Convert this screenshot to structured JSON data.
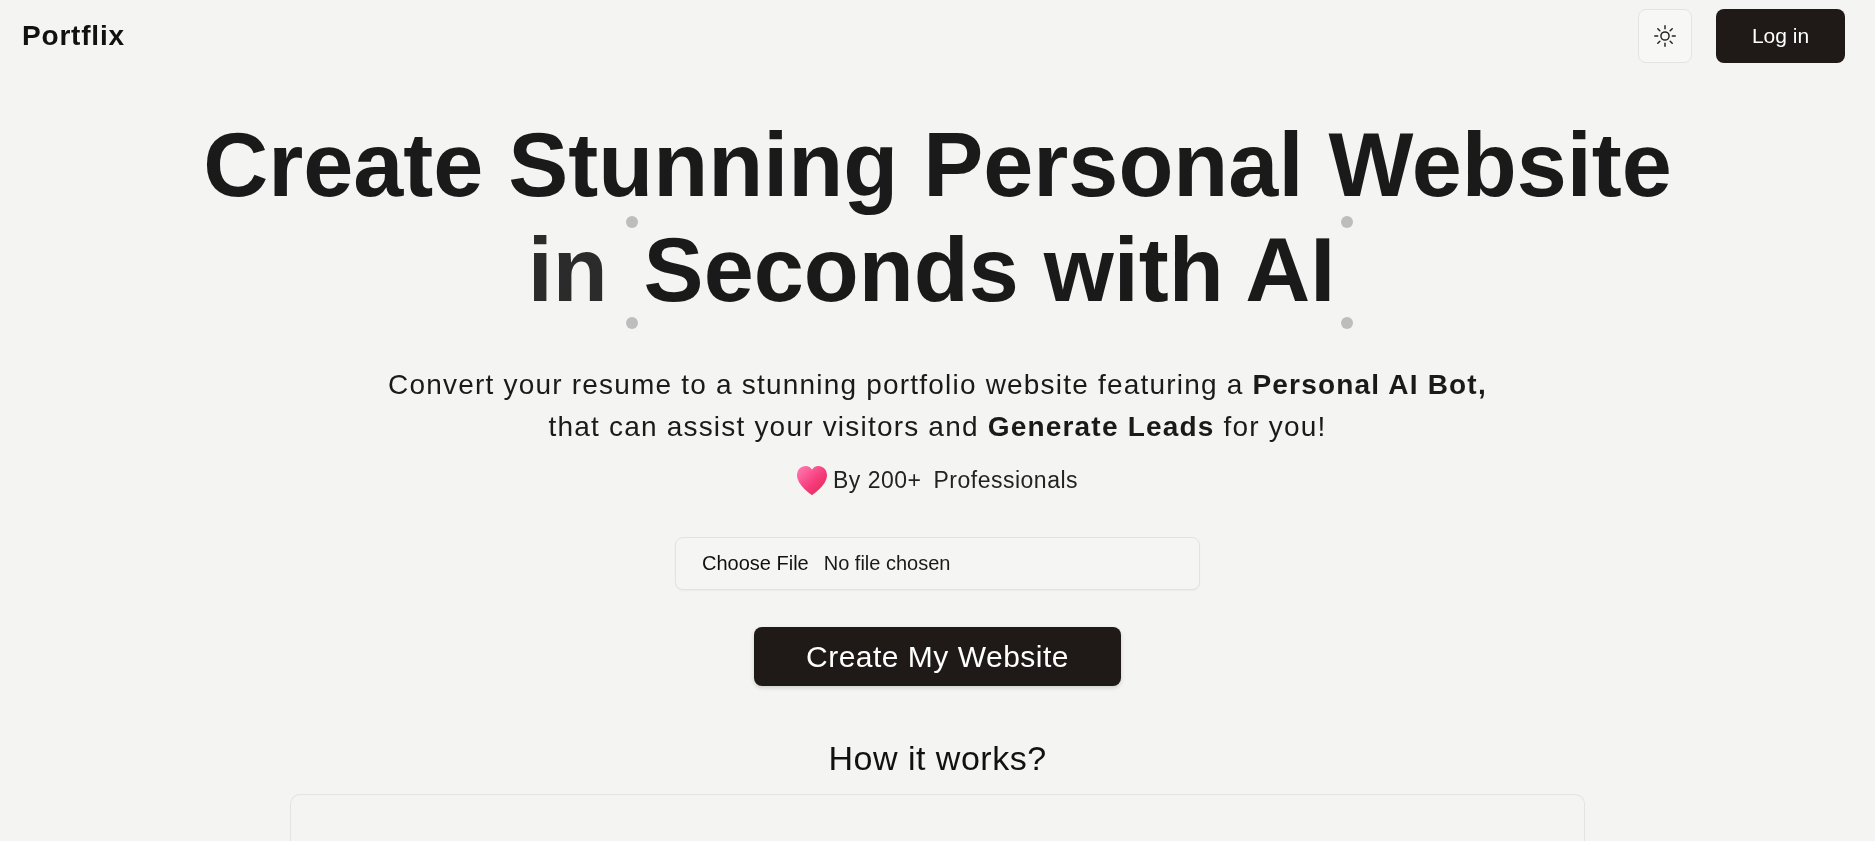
{
  "header": {
    "logo": "Portflix",
    "login_button": "Log in"
  },
  "hero": {
    "headline": {
      "line_1": "Create Stunning Personal Website",
      "line_2": "in",
      "highlight": {
        "text": "Seconds with AI",
        "selected": true
      }
    },
    "subtitle": [
      "Convert your resume to a stunning portfolio website featuring a **Personal AI Bot,**",
      "that can assist your visitors and **Generate Leads** for you!"
    ],
    "social_proof": {
      "count": "By 200+",
      "label": "Professionals"
    },
    "file_input": {
      "button": "Choose File",
      "status": "No file chosen"
    },
    "cta_button": "Create My Website"
  },
  "how_it_works": {
    "title": "How it works?"
  }
}
